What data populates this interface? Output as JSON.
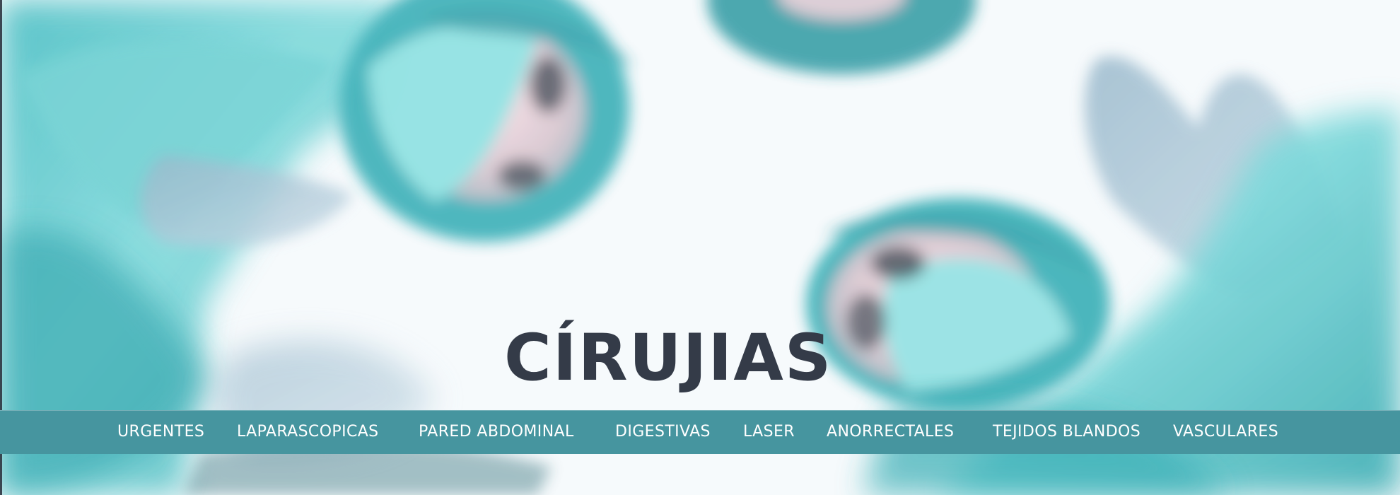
{
  "page": {
    "title": "CÍRUJIAS"
  },
  "hero": {
    "background_description_icon": "surgeons-looking-down-photo",
    "palette": {
      "teal": "#4ac7cb",
      "light_teal": "#8ee0e2",
      "white": "#ffffff",
      "title": "#343b48",
      "nav_bar": "#46959f",
      "nav_text": "#ffffff"
    }
  },
  "nav": {
    "items": [
      {
        "label": "URGENTES"
      },
      {
        "label": "LAPARASCOPICAS"
      },
      {
        "label": "PARED ABDOMINAL"
      },
      {
        "label": "DIGESTIVAS"
      },
      {
        "label": "LASER"
      },
      {
        "label": "ANORRECTALES"
      },
      {
        "label": "TEJIDOS BLANDOS"
      },
      {
        "label": "VASCULARES"
      }
    ]
  }
}
